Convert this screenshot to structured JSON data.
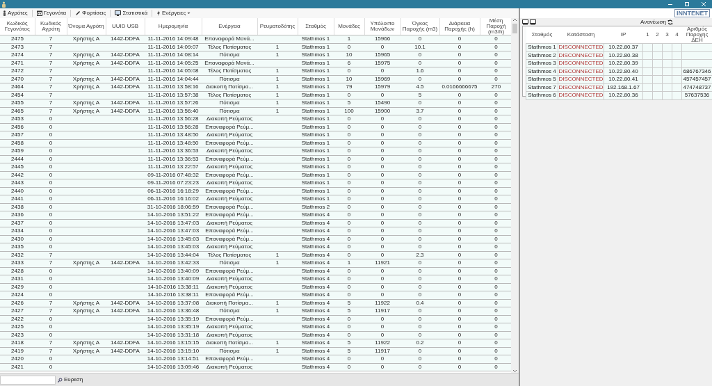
{
  "toolbar": [
    {
      "label": "Αγρότες",
      "kind": "button"
    },
    {
      "label": "Γεγονότα",
      "kind": "button"
    },
    {
      "label": "Φορτίσεις",
      "kind": "button"
    },
    {
      "label": "Στατιστικά",
      "kind": "button"
    },
    {
      "label": "Ενέργειες",
      "kind": "dropdown"
    }
  ],
  "events_table": {
    "columns": [
      "Κωδικός Γεγονότος",
      "Κωδικός Αγρότη",
      "Όνομα Αγρότη",
      "UUID USB",
      "Ημερομηνία",
      "Ενέργεια",
      "Ρευματοδότης",
      "Σταθμός",
      "Μονάδες",
      "Υπόλοιπο Μονάδων",
      "Όγκος Παροχής (m3)",
      "Διάρκεια Παροχής (h)",
      "Μέση Παροχή (m3/h)"
    ],
    "rows": [
      [
        "2475",
        "7",
        "Χρήστης A",
        "1442-DDFA",
        "11-11-2016 14:09:48",
        "Επαναφορά Μονά...",
        null,
        "Stathmos 1",
        "1",
        "15966",
        "0",
        "0",
        "0"
      ],
      [
        "2473",
        "7",
        null,
        null,
        "11-11-2016 14:09:07",
        "Τέλος Ποτίσματος",
        "1",
        "Stathmos 1",
        "0",
        "0",
        "10.1",
        "0",
        "0"
      ],
      [
        "2474",
        "7",
        "Χρήστης A",
        "1442-DDFA",
        "11-11-2016 14:08:14",
        "Πότισμα",
        "1",
        "Stathmos 1",
        "10",
        "15965",
        "0",
        "0",
        "0"
      ],
      [
        "2471",
        "7",
        "Χρήστης A",
        "1442-DDFA",
        "11-11-2016 14:05:25",
        "Επαναφορά Μονά...",
        null,
        "Stathmos 1",
        "6",
        "15975",
        "0",
        "0",
        "0"
      ],
      [
        "2472",
        "7",
        null,
        null,
        "11-11-2016 14:05:08",
        "Τέλος Ποτίσματος",
        "1",
        "Stathmos 1",
        "0",
        "0",
        "1.6",
        "0",
        "0"
      ],
      [
        "2470",
        "7",
        "Χρήστης A",
        "1442-DDFA",
        "11-11-2016 14:04:44",
        "Πότισμα",
        "1",
        "Stathmos 1",
        "10",
        "15969",
        "0",
        "0",
        "0"
      ],
      [
        "2464",
        "7",
        "Χρήστης A",
        "1442-DDFA",
        "11-11-2016 13:58:16",
        "Διακοπή Ποτίσμα...",
        "1",
        "Stathmos 1",
        "79",
        "15979",
        "4.5",
        "0.0166666675",
        "270"
      ],
      [
        "2454",
        "7",
        null,
        null,
        "11-11-2016 13:57:38",
        "Τέλος Ποτίσματος",
        "1",
        "Stathmos 1",
        "0",
        "0",
        "5",
        "0",
        "0"
      ],
      [
        "2455",
        "7",
        "Χρήστης A",
        "1442-DDFA",
        "11-11-2016 13:57:26",
        "Πότισμα",
        "1",
        "Stathmos 1",
        "5",
        "15490",
        "0",
        "0",
        "0"
      ],
      [
        "2465",
        "7",
        "Χρήστης A",
        "1442-DDFA",
        "11-11-2016 13:56:40",
        "Πότισμα",
        "1",
        "Stathmos 1",
        "100",
        "15900",
        "3.7",
        "0",
        "0"
      ],
      [
        "2453",
        "0",
        null,
        null,
        "11-11-2016 13:56:28",
        "Διακοπή Ρεύματος",
        null,
        "Stathmos 1",
        "0",
        "0",
        "0",
        "0",
        "0"
      ],
      [
        "2456",
        "0",
        null,
        null,
        "11-11-2016 13:56:28",
        "Επαναφορά Ρεύμ...",
        null,
        "Stathmos 1",
        "0",
        "0",
        "0",
        "0",
        "0"
      ],
      [
        "2457",
        "0",
        null,
        null,
        "11-11-2016 13:48:50",
        "Διακοπή Ρεύματος",
        null,
        "Stathmos 1",
        "0",
        "0",
        "0",
        "0",
        "0"
      ],
      [
        "2458",
        "0",
        null,
        null,
        "11-11-2016 13:48:50",
        "Επαναφορά Ρεύμ...",
        null,
        "Stathmos 1",
        "0",
        "0",
        "0",
        "0",
        "0"
      ],
      [
        "2459",
        "0",
        null,
        null,
        "11-11-2016 13:36:53",
        "Διακοπή Ρεύματος",
        null,
        "Stathmos 1",
        "0",
        "0",
        "0",
        "0",
        "0"
      ],
      [
        "2444",
        "0",
        null,
        null,
        "11-11-2016 13:36:53",
        "Επαναφορά Ρεύμ...",
        null,
        "Stathmos 1",
        "0",
        "0",
        "0",
        "0",
        "0"
      ],
      [
        "2445",
        "0",
        null,
        null,
        "11-11-2016 13:22:57",
        "Διακοπή Ρεύματος",
        null,
        "Stathmos 1",
        "0",
        "0",
        "0",
        "0",
        "0"
      ],
      [
        "2442",
        "0",
        null,
        null,
        "09-11-2016 07:48:32",
        "Επαναφορά Ρεύμ...",
        null,
        "Stathmos 1",
        "0",
        "0",
        "0",
        "0",
        "0"
      ],
      [
        "2443",
        "0",
        null,
        null,
        "09-11-2016 07:23:23",
        "Διακοπή Ρεύματος",
        null,
        "Stathmos 1",
        "0",
        "0",
        "0",
        "0",
        "0"
      ],
      [
        "2440",
        "0",
        null,
        null,
        "06-11-2016 16:18:29",
        "Επαναφορά Ρεύμ...",
        null,
        "Stathmos 1",
        "0",
        "0",
        "0",
        "0",
        "0"
      ],
      [
        "2441",
        "0",
        null,
        null,
        "06-11-2016 16:16:02",
        "Διακοπή Ρεύματος",
        null,
        "Stathmos 1",
        "0",
        "0",
        "0",
        "0",
        "0"
      ],
      [
        "2438",
        "0",
        null,
        null,
        "31-10-2016 18:06:59",
        "Επαναφορά Ρεύμ...",
        null,
        "Stathmos 2",
        "0",
        "0",
        "0",
        "0",
        "0"
      ],
      [
        "2436",
        "0",
        null,
        null,
        "14-10-2016 13:51:22",
        "Επαναφορά Ρεύμ...",
        null,
        "Stathmos 4",
        "0",
        "0",
        "0",
        "0",
        "0"
      ],
      [
        "2437",
        "0",
        null,
        null,
        "14-10-2016 13:47:03",
        "Διακοπή Ρεύματος",
        null,
        "Stathmos 4",
        "0",
        "0",
        "0",
        "0",
        "0"
      ],
      [
        "2434",
        "0",
        null,
        null,
        "14-10-2016 13:47:03",
        "Επαναφορά Ρεύμ...",
        null,
        "Stathmos 4",
        "0",
        "0",
        "0",
        "0",
        "0"
      ],
      [
        "2430",
        "0",
        null,
        null,
        "14-10-2016 13:45:03",
        "Επαναφορά Ρεύμ...",
        null,
        "Stathmos 4",
        "0",
        "0",
        "0",
        "0",
        "0"
      ],
      [
        "2435",
        "0",
        null,
        null,
        "14-10-2016 13:45:03",
        "Διακοπή Ρεύματος",
        null,
        "Stathmos 4",
        "0",
        "0",
        "0",
        "0",
        "0"
      ],
      [
        "2432",
        "7",
        null,
        null,
        "14-10-2016 13:44:04",
        "Τέλος Ποτίσματος",
        "1",
        "Stathmos 4",
        "0",
        "0",
        "2.3",
        "0",
        "0"
      ],
      [
        "2433",
        "7",
        "Χρήστης A",
        "1442-DDFA",
        "14-10-2016 13:42:33",
        "Πότισμα",
        "1",
        "Stathmos 4",
        "1",
        "11921",
        "0",
        "0",
        "0"
      ],
      [
        "2428",
        "0",
        null,
        null,
        "14-10-2016 13:40:09",
        "Επαναφορά Ρεύμ...",
        null,
        "Stathmos 4",
        "0",
        "0",
        "0",
        "0",
        "0"
      ],
      [
        "2431",
        "0",
        null,
        null,
        "14-10-2016 13:40:09",
        "Διακοπή Ρεύματος",
        null,
        "Stathmos 4",
        "0",
        "0",
        "0",
        "0",
        "0"
      ],
      [
        "2429",
        "0",
        null,
        null,
        "14-10-2016 13:38:11",
        "Διακοπή Ρεύματος",
        null,
        "Stathmos 4",
        "0",
        "0",
        "0",
        "0",
        "0"
      ],
      [
        "2424",
        "0",
        null,
        null,
        "14-10-2016 13:38:11",
        "Επαναφορά Ρεύμ...",
        null,
        "Stathmos 4",
        "0",
        "0",
        "0",
        "0",
        "0"
      ],
      [
        "2426",
        "7",
        "Χρήστης A",
        "1442-DDFA",
        "14-10-2016 13:37:08",
        "Διακοπή Ποτίσμα...",
        "1",
        "Stathmos 4",
        "5",
        "11922",
        "0.4",
        "0",
        "0"
      ],
      [
        "2427",
        "7",
        "Χρήστης A",
        "1442-DDFA",
        "14-10-2016 13:36:48",
        "Πότισμα",
        "1",
        "Stathmos 4",
        "5",
        "11917",
        "0",
        "0",
        "0"
      ],
      [
        "2422",
        "0",
        null,
        null,
        "14-10-2016 13:35:19",
        "Επαναφορά Ρεύμ...",
        null,
        "Stathmos 4",
        "0",
        "0",
        "0",
        "0",
        "0"
      ],
      [
        "2425",
        "0",
        null,
        null,
        "14-10-2016 13:35:19",
        "Διακοπή Ρεύματος",
        null,
        "Stathmos 4",
        "0",
        "0",
        "0",
        "0",
        "0"
      ],
      [
        "2423",
        "0",
        null,
        null,
        "14-10-2016 13:31:18",
        "Διακοπή Ρεύματος",
        null,
        "Stathmos 4",
        "0",
        "0",
        "0",
        "0",
        "0"
      ],
      [
        "2418",
        "7",
        "Χρήστης A",
        "1442-DDFA",
        "14-10-2016 13:15:15",
        "Διακοπή Ποτίσμα...",
        "1",
        "Stathmos 4",
        "5",
        "11922",
        "0.2",
        "0",
        "0"
      ],
      [
        "2419",
        "7",
        "Χρήστης A",
        "1442-DDFA",
        "14-10-2016 13:15:10",
        "Πότισμα",
        "1",
        "Stathmos 4",
        "5",
        "11917",
        "0",
        "0",
        "0"
      ],
      [
        "2420",
        "0",
        null,
        null,
        "14-10-2016 13:14:51",
        "Επαναφορά Ρεύμ...",
        null,
        "Stathmos 4",
        "0",
        "0",
        "0",
        "0",
        "0"
      ],
      [
        "2421",
        "0",
        null,
        null,
        "14-10-2016 13:09:46",
        "Διακοπή Ρεύματος",
        null,
        "Stathmos 4",
        "0",
        "0",
        "0",
        "0",
        "0"
      ]
    ]
  },
  "search": {
    "button": "Ευρεση"
  },
  "logo": "INNTENET",
  "stations_panel": {
    "refresh": "Ανανέωση",
    "columns": [
      "Σταθμός",
      "Κατάσταση",
      "IP",
      "1",
      "2",
      "3",
      "4",
      "Αριθμός Παροχής ΔΕΗ"
    ],
    "rows": [
      [
        "Stathmos 1",
        "DISCONNECTED",
        "10.22.80.37",
        null,
        null,
        null,
        null,
        null
      ],
      [
        "Stathmos 2",
        "DISCONNECTED",
        "10.22.80.38",
        null,
        null,
        null,
        null,
        null
      ],
      [
        "Stathmos 3",
        "DISCONNECTED",
        "10.22.80.39",
        null,
        null,
        null,
        null,
        null
      ],
      [
        "Stathmos 4",
        "DISCONNECTED",
        "10.22.80.40",
        null,
        null,
        null,
        null,
        "686767346"
      ],
      [
        "Stathmos 5",
        "DISCONNECTED",
        "10.22.80.41",
        null,
        null,
        null,
        null,
        "457457457"
      ],
      [
        "Stathmos 7",
        "DISCONNECTED",
        "192.168.1.67",
        null,
        null,
        null,
        null,
        "474748737"
      ],
      [
        "Stathmos 6",
        "DISCONNECTED",
        "10.22.80.36",
        null,
        null,
        null,
        null,
        "57637536"
      ]
    ]
  }
}
